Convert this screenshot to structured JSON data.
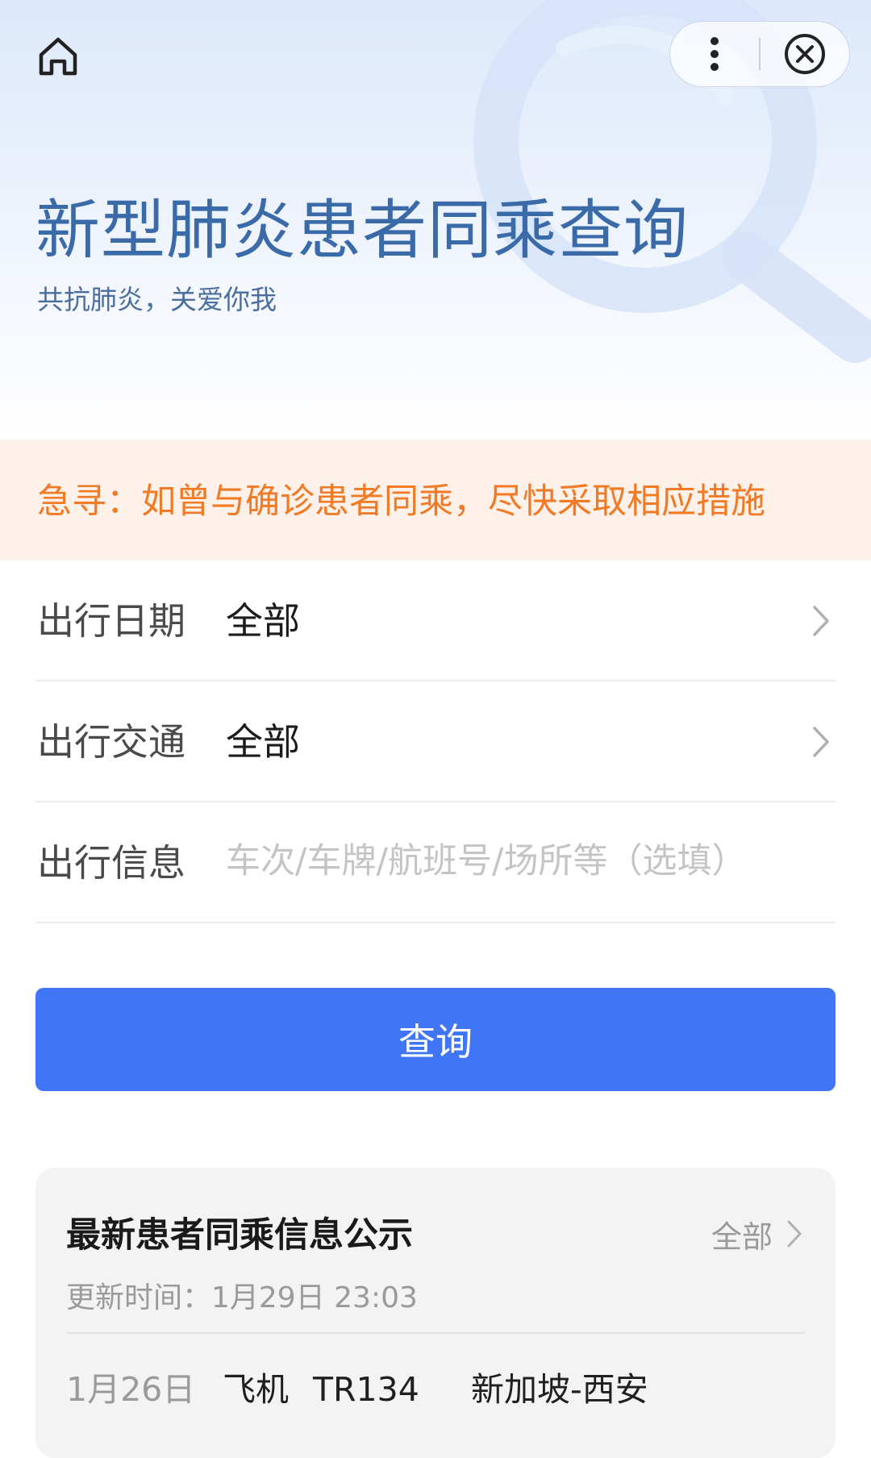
{
  "hero": {
    "title": "新型肺炎患者同乘查询",
    "subtitle": "共抗肺炎，关爱你我",
    "home_icon": "home-icon",
    "more_icon": "more-vertical-icon",
    "close_icon": "close-circle-icon"
  },
  "notice": {
    "text": "急寻：如曾与确诊患者同乘，尽快采取相应措施"
  },
  "form": {
    "date": {
      "label": "出行日期",
      "value": "全部"
    },
    "transport": {
      "label": "出行交通",
      "value": "全部"
    },
    "info": {
      "label": "出行信息",
      "placeholder": "车次/车牌/航班号/场所等（选填）",
      "value": ""
    }
  },
  "query_button": {
    "label": "查询"
  },
  "latest": {
    "title": "最新患者同乘信息公示",
    "all_label": "全部",
    "update_time": "更新时间：1月29日 23:03",
    "records": [
      {
        "date": "1月26日",
        "transport": "飞机",
        "number": "TR134",
        "route": "新加坡-西安"
      }
    ]
  },
  "colors": {
    "title_blue": "#3b6aa8",
    "notice_orange": "#f37a25",
    "notice_bg": "#fdf1ea",
    "button_blue": "#4076f5"
  }
}
